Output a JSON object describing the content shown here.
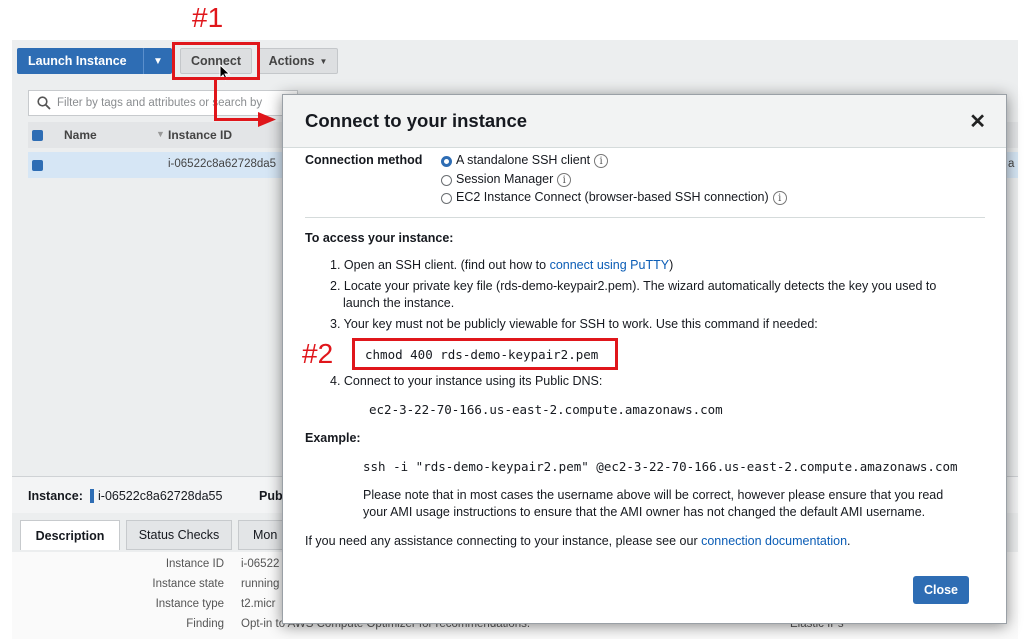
{
  "annotations": {
    "step1": "#1",
    "step2": "#2"
  },
  "toolbar": {
    "launch_label": "Launch Instance",
    "connect_label": "Connect",
    "actions_label": "Actions"
  },
  "filter": {
    "placeholder": "Filter by tags and attributes or search by"
  },
  "table": {
    "headers": [
      "Name",
      "Instance ID"
    ],
    "rows": [
      {
        "name": "",
        "instance_id": "i-06522c8a62728da5"
      }
    ]
  },
  "lower": {
    "instance_label": "Instance:",
    "instance_id": "i-06522c8a62728da55",
    "pub_label": "Pub"
  },
  "tabs": [
    "Description",
    "Status Checks",
    "Mon"
  ],
  "details": [
    {
      "label": "Instance ID",
      "value": "i-06522"
    },
    {
      "label": "Instance state",
      "value": "running"
    },
    {
      "label": "Instance type",
      "value": "t2.micr"
    },
    {
      "label": "Finding",
      "value": "Opt-in to AWS Compute Optimizer for recommendations."
    }
  ],
  "details_right": {
    "elastic_ips": "Elastic IPs",
    "edge_char": "a"
  },
  "modal": {
    "title": "Connect to your instance",
    "close_icon": "close-icon",
    "connection_method_label": "Connection method",
    "methods": [
      {
        "label": "A standalone SSH client",
        "selected": true
      },
      {
        "label": "Session Manager",
        "selected": false
      },
      {
        "label": "EC2 Instance Connect (browser-based SSH connection)",
        "selected": false
      }
    ],
    "info_glyph": "i",
    "access_heading": "To access your instance:",
    "steps": {
      "s1_prefix": "1. Open an SSH client. (find out how to ",
      "s1_link": "connect using PuTTY",
      "s1_suffix": ")",
      "s2_line1": "2. Locate your private key file (rds-demo-keypair2.pem). The wizard automatically detects the key you used to",
      "s2_line2": "launch the instance.",
      "s3": "3. Your key must not be publicly viewable for SSH to work. Use this command if needed:",
      "chmod_cmd": "chmod 400 rds-demo-keypair2.pem",
      "s4": "4. Connect to your instance using its Public DNS:",
      "dns": "ec2-3-22-70-166.us-east-2.compute.amazonaws.com"
    },
    "example_heading": "Example:",
    "ssh_cmd": "ssh -i \"rds-demo-keypair2.pem\" @ec2-3-22-70-166.us-east-2.compute.amazonaws.com",
    "note_line1": "Please note that in most cases the username above will be correct, however please ensure that you read",
    "note_line2": "your AMI usage instructions to ensure that the AMI owner has not changed the default AMI username.",
    "help_prefix": "If you need any assistance connecting to your instance, please see our ",
    "help_link": "connection documentation",
    "help_suffix": ".",
    "close_button": "Close"
  },
  "colors": {
    "accent": "#2e6db4",
    "annotation": "#e0161b",
    "link": "#0b5db6"
  }
}
